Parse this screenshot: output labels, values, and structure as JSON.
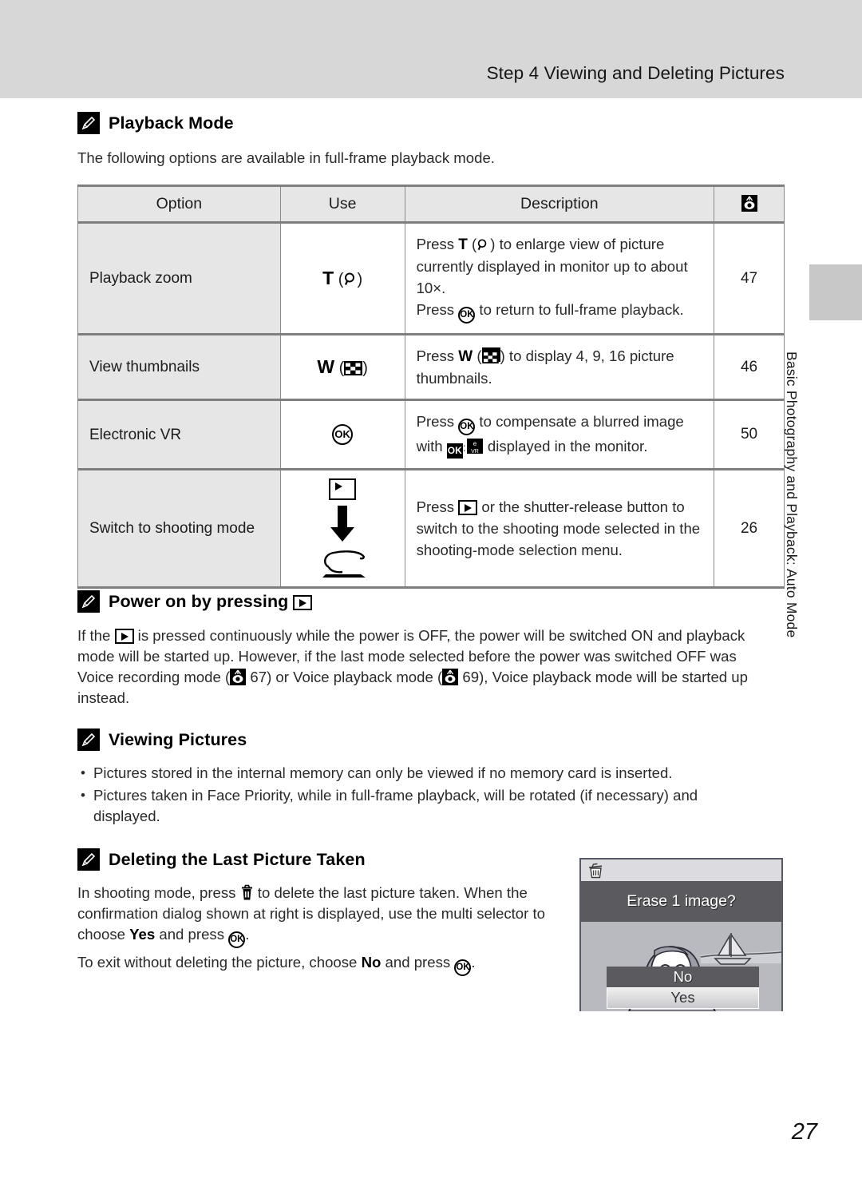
{
  "header": {
    "title": "Step 4 Viewing and Deleting Pictures"
  },
  "side_tab": {
    "label": "Basic Photography and Playback: Auto Mode"
  },
  "page_number": "27",
  "playback_mode": {
    "heading": "Playback Mode",
    "intro": "The following options are available in full-frame playback mode.",
    "table": {
      "columns": [
        "Option",
        "Use",
        "Description",
        "reference-icon"
      ],
      "rows": [
        {
          "option": "Playback zoom",
          "use_letter": "T",
          "use_icon": "magnifier-icon",
          "desc_line1_a": "Press ",
          "desc_line1_b": " to enlarge view of picture currently displayed in monitor up to about 10×.",
          "desc_line2_a": "Press ",
          "desc_line2_b": " to return to full-frame playback.",
          "page": "47"
        },
        {
          "option": "View thumbnails",
          "use_letter": "W",
          "use_icon": "thumbnail-grid-icon",
          "desc_a": "Press ",
          "desc_b": " to display 4, 9, 16 picture thumbnails.",
          "page": "46"
        },
        {
          "option": "Electronic VR",
          "use_letter": "",
          "use_icon": "ok-button-icon",
          "desc_a": "Press ",
          "desc_b": " to compensate a blurred image with ",
          "desc_c": " displayed in the monitor.",
          "page": "50"
        },
        {
          "option": "Switch to shooting mode",
          "use_letter": "",
          "use_icon": "playback-arrow-down-shutter-icon",
          "desc_a": "Press ",
          "desc_b": " or the shutter-release button to switch to the shooting mode selected in the shooting-mode selection menu.",
          "page": "26"
        }
      ]
    }
  },
  "power_on": {
    "heading_a": "Power on by pressing ",
    "text_a": "If the ",
    "text_b": " is pressed continuously while the power is OFF, the power will be switched ON and playback mode will be started up. However, if the last mode selected before the power was switched OFF was Voice recording mode (",
    "ref_1": " 67",
    "text_c": ") or Voice playback mode (",
    "ref_2": " 69",
    "text_d": "), Voice playback mode will be started up instead."
  },
  "viewing_pictures": {
    "heading": "Viewing Pictures",
    "bullets": [
      "Pictures stored in the internal memory can only be viewed if no memory card is inserted.",
      "Pictures taken in Face Priority, while in full-frame playback, will be rotated (if necessary) and displayed."
    ]
  },
  "deleting": {
    "heading": "Deleting the Last Picture Taken",
    "p1_a": "In shooting mode, press ",
    "p1_b": " to delete the last picture taken. When the confirmation dialog shown at right is displayed, use the multi selector to choose ",
    "p1_yes": "Yes",
    "p1_c": " and press ",
    "p1_d": ".",
    "p2_a": "To exit without deleting the picture, choose ",
    "p2_no": "No",
    "p2_b": " and press ",
    "p2_c": "."
  },
  "lcd_dialog": {
    "title": "Erase 1 image?",
    "option_no": "No",
    "option_yes": "Yes",
    "trash_icon": "trash-can-icon"
  },
  "colors": {
    "header_band": "#d7d7d7",
    "table_header_bg": "#e6e6e6",
    "table_border": "#7e7e7e",
    "lcd_bar": "#5b5b5f",
    "side_tab": "#c8c8c8"
  }
}
